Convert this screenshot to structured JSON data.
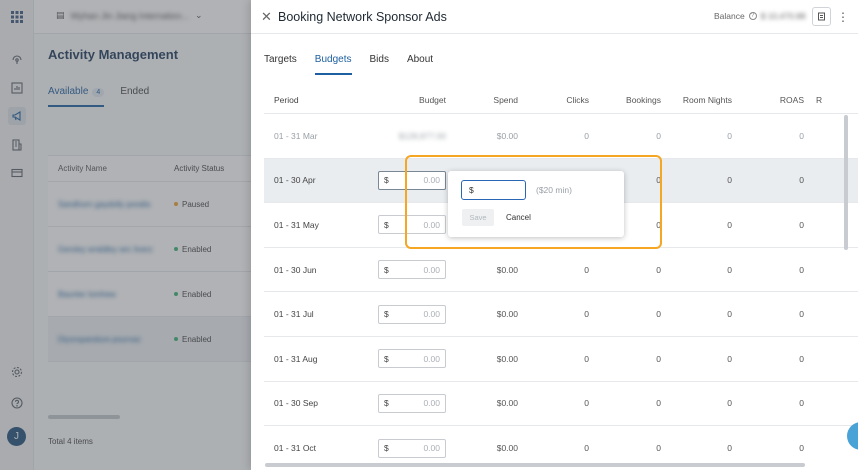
{
  "left_rail": {
    "icons": [
      "apps-icon",
      "satellite-icon",
      "chart-icon",
      "megaphone-icon",
      "building-icon",
      "card-icon",
      "gear-icon",
      "help-icon"
    ],
    "avatar_initial": "J"
  },
  "background": {
    "org_name": "Wyhan Jin Jiang Internation...",
    "page_title": "Activity Management",
    "tabs": [
      {
        "label": "Available",
        "count": "4"
      },
      {
        "label": "Ended"
      }
    ],
    "table_headers": [
      "Activity Name",
      "Activity Status"
    ],
    "rows": [
      {
        "name": "Sandhorn gaydolly poralts",
        "status": "Paused",
        "status_color": "#f0a030"
      },
      {
        "name": "Gersley wraldley wrc liverz",
        "status": "Enabled",
        "status_color": "#3bb273"
      },
      {
        "name": "Baunter lomhew",
        "status": "Enabled",
        "status_color": "#3bb273"
      },
      {
        "name": "Diyorspandure pourvaz",
        "status": "Enabled",
        "status_color": "#3bb273"
      }
    ],
    "footer_total": "Total 4 items"
  },
  "drawer": {
    "title": "Booking Network Sponsor Ads",
    "balance_label": "Balance",
    "balance_value": "$ 10,470.88",
    "tabs": [
      "Targets",
      "Budgets",
      "Bids",
      "About"
    ],
    "active_tab": "Budgets",
    "table": {
      "headers": [
        "Period",
        "Budget",
        "Spend",
        "Clicks",
        "Bookings",
        "Room Nights",
        "ROAS",
        "R"
      ],
      "first_row": {
        "period": "01 - 31 Mar",
        "budget": "$128,877.00",
        "spend": "$0.00",
        "clicks": "0",
        "bookings": "0",
        "room_nights": "0",
        "roas": "0"
      },
      "rows": [
        {
          "period": "01 - 30 Apr",
          "currency": "$",
          "placeholder": "0.00",
          "spend": "",
          "clicks": "",
          "bookings": "0",
          "room_nights": "0",
          "roas": "0"
        },
        {
          "period": "01 - 31 May",
          "currency": "$",
          "placeholder": "0.00",
          "spend": "",
          "clicks": "",
          "bookings": "0",
          "room_nights": "0",
          "roas": "0"
        },
        {
          "period": "01 - 30 Jun",
          "currency": "$",
          "placeholder": "0.00",
          "spend": "$0.00",
          "clicks": "0",
          "bookings": "0",
          "room_nights": "0",
          "roas": "0"
        },
        {
          "period": "01 - 31 Jul",
          "currency": "$",
          "placeholder": "0.00",
          "spend": "$0.00",
          "clicks": "0",
          "bookings": "0",
          "room_nights": "0",
          "roas": "0"
        },
        {
          "period": "01 - 31 Aug",
          "currency": "$",
          "placeholder": "0.00",
          "spend": "$0.00",
          "clicks": "0",
          "bookings": "0",
          "room_nights": "0",
          "roas": "0"
        },
        {
          "period": "01 - 30 Sep",
          "currency": "$",
          "placeholder": "0.00",
          "spend": "$0.00",
          "clicks": "0",
          "bookings": "0",
          "room_nights": "0",
          "roas": "0"
        },
        {
          "period": "01 - 31 Oct",
          "currency": "$",
          "placeholder": "0.00",
          "spend": "$0.00",
          "clicks": "0",
          "bookings": "0",
          "room_nights": "0",
          "roas": "0"
        }
      ]
    },
    "popover": {
      "input_value": "$",
      "min_hint": "($20 min)",
      "save_label": "Save",
      "cancel_label": "Cancel"
    }
  },
  "colors": {
    "accent": "#1d5fa0",
    "highlight": "#f5a623"
  }
}
